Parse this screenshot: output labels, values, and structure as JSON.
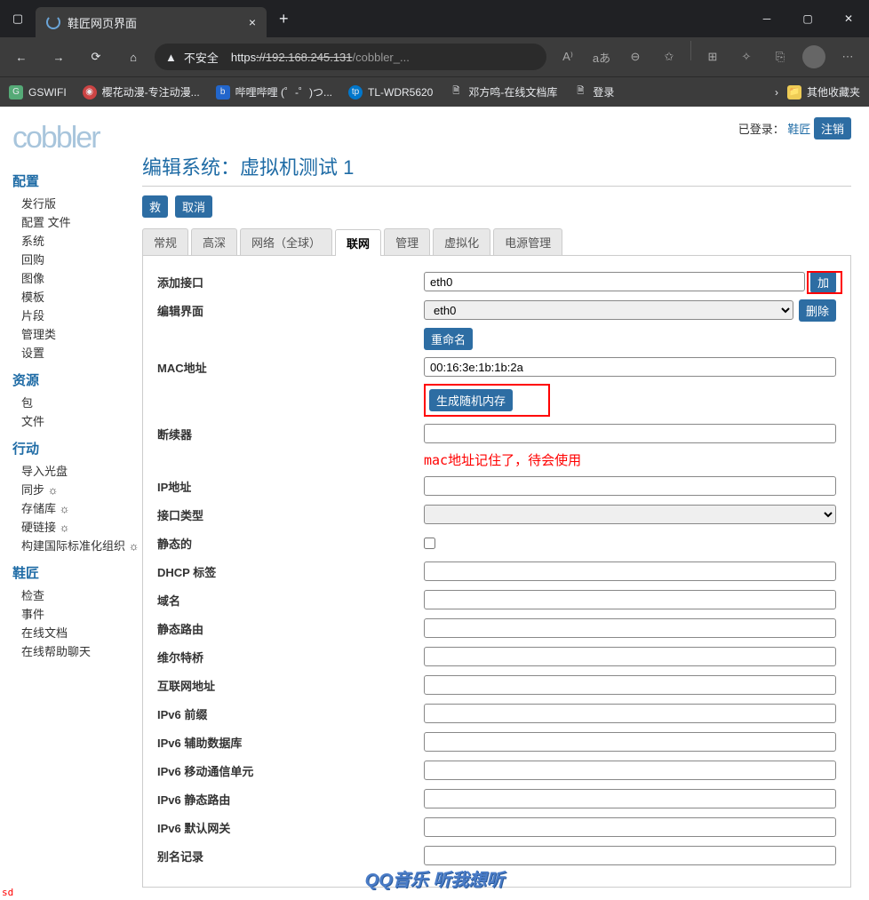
{
  "browser": {
    "tab_title": "鞋匠网页界面",
    "url_scheme": "https",
    "url_host": "://192.168.245.131",
    "url_path": "/cobbler_...",
    "security_label": "不安全",
    "translate_label": "aあ"
  },
  "bookmarks": [
    {
      "label": "GSWIFI"
    },
    {
      "label": "樱花动漫-专注动漫..."
    },
    {
      "label": "哔哩哔哩 (゜-゜)つ..."
    },
    {
      "label": "TL-WDR5620"
    },
    {
      "label": "邓方鸣-在线文档库"
    },
    {
      "label": "登录"
    }
  ],
  "bookmarks_overflow": "其他收藏夹",
  "login_bar": {
    "prefix": "已登录：",
    "user": "鞋匠",
    "logout": "注销"
  },
  "logo_text": "cobbler",
  "sidebar": {
    "sections": [
      {
        "title": "配置",
        "items": [
          "发行版",
          "配置 文件",
          "系统",
          "回购",
          "图像",
          "模板",
          "片段",
          "管理类",
          "设置"
        ]
      },
      {
        "title": "资源",
        "items": [
          "包",
          "文件"
        ]
      },
      {
        "title": "行动",
        "items": [
          "导入光盘",
          "同步 ☼",
          "存储库 ☼",
          "硬链接 ☼",
          "构建国际标准化组织 ☼"
        ]
      },
      {
        "title": "鞋匠",
        "items": [
          "检查",
          "事件",
          "在线文档",
          "在线帮助聊天"
        ]
      }
    ]
  },
  "page_title": "编辑系统：虚拟机测试 1",
  "buttons": {
    "save": "救",
    "cancel": "取消",
    "add": "加",
    "delete": "删除",
    "rename": "重命名",
    "gen_mac": "生成随机内存"
  },
  "tabs": [
    "常规",
    "高深",
    "网络（全球）",
    "联网",
    "管理",
    "虚拟化",
    "电源管理"
  ],
  "active_tab_index": 3,
  "form": {
    "add_interface": {
      "label": "添加接口",
      "value": "eth0"
    },
    "edit_interface": {
      "label": "编辑界面",
      "value": "eth0"
    },
    "mac": {
      "label": "MAC地址",
      "value": "00:16:3e:1b:1b:2a"
    },
    "bonding": {
      "label": "断续器"
    },
    "ip": {
      "label": "IP地址"
    },
    "iface_type": {
      "label": "接口类型"
    },
    "static": {
      "label": "静态的"
    },
    "dhcp_tag": {
      "label": "DHCP 标签"
    },
    "domain": {
      "label": "域名"
    },
    "static_route": {
      "label": "静态路由"
    },
    "virt_bridge": {
      "label": "维尔特桥"
    },
    "inet_addr": {
      "label": "互联网地址"
    },
    "ipv6_prefix": {
      "label": "IPv6 前缀"
    },
    "ipv6_secondaries": {
      "label": "IPv6 辅助数据库"
    },
    "ipv6_mtu": {
      "label": "IPv6 移动通信单元"
    },
    "ipv6_static_route": {
      "label": "IPv6 静态路由"
    },
    "ipv6_gateway": {
      "label": "IPv6 默认网关"
    },
    "cnames": {
      "label": "别名记录"
    }
  },
  "annotation": "mac地址记住了，待会使用",
  "footer_music": "QQ音乐 听我想听",
  "corner": "sd"
}
